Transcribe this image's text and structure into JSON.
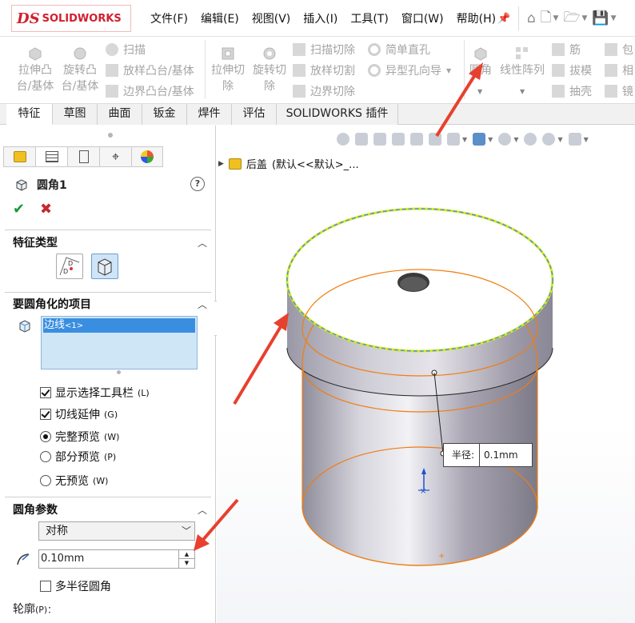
{
  "brand": {
    "ds": "DS",
    "name": "SOLIDWORKS"
  },
  "menu": [
    "文件(F)",
    "编辑(E)",
    "视图(V)",
    "插入(I)",
    "工具(T)",
    "窗口(W)",
    "帮助(H)"
  ],
  "toolbar": {
    "extrude_boss": [
      "拉伸凸",
      "台/基体"
    ],
    "revolve_boss": [
      "旋转凸",
      "台/基体"
    ],
    "sweep": "扫描",
    "loft_boss": "放样凸台/基体",
    "boundary_boss": "边界凸台/基体",
    "extrude_cut": [
      "拉伸切",
      "除"
    ],
    "revolve_cut": [
      "旋转切",
      "除"
    ],
    "swept_cut": "扫描切除",
    "lofted_cut": "放样切割",
    "boundary_cut": "边界切除",
    "simple_hole": "简单直孔",
    "hole_wizard": "异型孔向导",
    "fillet": "圆角",
    "linear_pattern": "线性阵列",
    "rib": "筋",
    "draft": "拔模",
    "shell": "抽壳",
    "wrap": "包",
    "intersect": "相",
    "mirror": "镜"
  },
  "tabs": [
    "特征",
    "草图",
    "曲面",
    "钣金",
    "焊件",
    "评估",
    "SOLIDWORKS 插件"
  ],
  "property_manager": {
    "title": "圆角1",
    "help": "?",
    "ok": "✔",
    "cancel": "✖",
    "feature_type_title": "特征类型",
    "items_title": "要圆角化的项目",
    "edge_item": "边线",
    "edge_index": "<1>",
    "show_toolbar": "显示选择工具栏",
    "show_toolbar_key": "(L)",
    "tangent": "切线延伸",
    "tangent_key": "(G)",
    "full_preview": "完整预览",
    "full_preview_key": "(W)",
    "partial_preview": "部分预览",
    "partial_preview_key": "(P)",
    "no_preview": "无预览",
    "no_preview_key": "(W)",
    "params_title": "圆角参数",
    "method": "对称",
    "radius_value": "0.10mm",
    "multi_radius": "多半径圆角",
    "profile_label": "轮廓",
    "profile_key": "(P)：",
    "checkboxes": {
      "show_toolbar": true,
      "tangent": true,
      "multi_radius": false
    },
    "preview_mode": "full"
  },
  "tree": {
    "part_name": "后盖",
    "config": "(默认<<默认>_..."
  },
  "callout": {
    "label": "半径:",
    "value": "0.1mm"
  },
  "colors": {
    "accent_red": "#e8402f",
    "selection_blue": "#3a8ee0",
    "edge_orange": "#f07d12",
    "edge_yellow": "#e8e81a"
  }
}
